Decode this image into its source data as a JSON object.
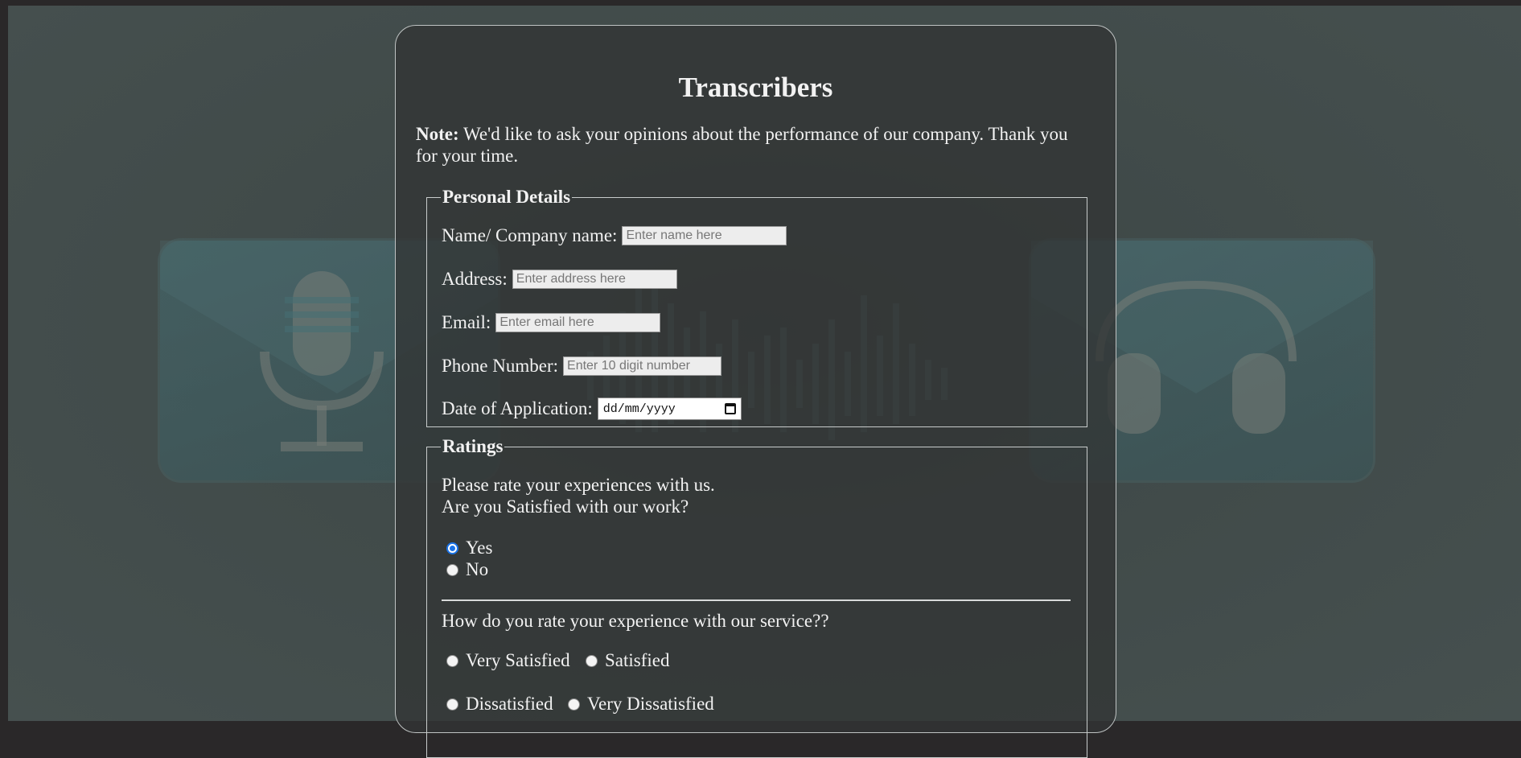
{
  "form": {
    "title": "Transcribers",
    "note_label": "Note:",
    "note_text": "We'd like to ask your opinions about the performance of our company. Thank you for your time."
  },
  "personal": {
    "legend": "Personal Details",
    "name_label": "Name/ Company name:",
    "name_placeholder": "Enter name here",
    "address_label": "Address:",
    "address_placeholder": "Enter address here",
    "email_label": "Email:",
    "email_placeholder": "Enter email here",
    "phone_label": "Phone Number:",
    "phone_placeholder": "Enter 10 digit number",
    "date_label": "Date of Application:",
    "date_value": "dd/mm/yyyy"
  },
  "ratings": {
    "legend": "Ratings",
    "intro": "Please rate your experiences with us.",
    "q1": "Are you Satisfied with our work?",
    "q1_options": [
      {
        "label": "Yes",
        "checked": true
      },
      {
        "label": "No",
        "checked": false
      }
    ],
    "q2": "How do you rate your experience with our service??",
    "q2_options": [
      {
        "label": "Very Satisfied",
        "checked": false
      },
      {
        "label": "Satisfied",
        "checked": false
      },
      {
        "label": "Dissatisfied",
        "checked": false
      },
      {
        "label": "Very Dissatisfied",
        "checked": false
      }
    ]
  },
  "colors": {
    "radio_accent": "#1a73e8",
    "card_border": "#bfc3c3"
  }
}
